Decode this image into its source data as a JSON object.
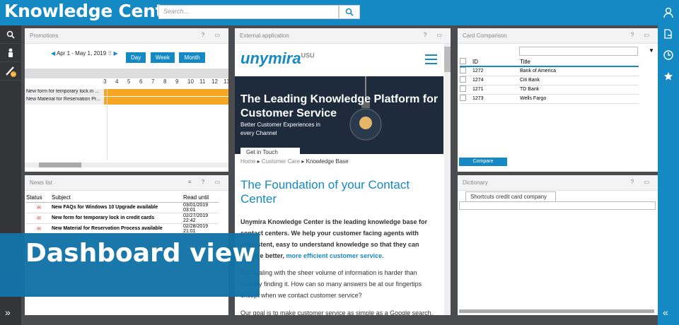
{
  "header": {
    "title": "Knowledge Center",
    "search_placeholder": "Search..."
  },
  "promotions": {
    "title": "Promotions",
    "controls": "? ▭",
    "date_range": "Apr 1 - May 1, 2019",
    "views": [
      "Day",
      "Week",
      "Month"
    ],
    "days": [
      "3",
      "4",
      "5",
      "6",
      "7",
      "8",
      "9",
      "10",
      "11",
      "12",
      "13"
    ],
    "rows": [
      "New form for temporary lock in ...",
      "New Material for Reservation Pr..."
    ]
  },
  "news": {
    "title": "News list",
    "controls": "≡ ? ▭",
    "cols": {
      "status": "Status",
      "subject": "Subject",
      "read_until": "Read until"
    },
    "rows": [
      {
        "subject": "New FAQs for Windows 10 Upgrade available",
        "date": "03/01/2019 03:01"
      },
      {
        "subject": "New form for temporary lock in credit cards",
        "date": "02/27/2019 22:42"
      },
      {
        "subject": "New Material for Reservation Process available",
        "date": "02/28/2019 21:01"
      }
    ]
  },
  "external": {
    "title": "External application",
    "controls": "? ▭",
    "brand": "unymira",
    "brand_sup": "USU",
    "hero_title": "The Leading Knowledge Platform for Customer Service",
    "hero_sub": "Better Customer Experiences in every Channel",
    "hero_button": "Get in Touch",
    "breadcrumb": [
      "Home",
      "Customer Care",
      "Knowledge Base"
    ],
    "heading": "The Foundation of your Contact Center",
    "p1": "Unymira Knowledge Center is the leading knowledge base for contact centers. We help your customer facing agents with consistent, easy to understand knowledge so that they can provide better,",
    "p1_link": "more efficient customer service.",
    "p2": "But dealing with the sheer volume of information is harder than actually finding it.  How can so many answers be at our fingertips except when we contact customer service?",
    "p3": "Our goal is to make customer service as simple as a Google search."
  },
  "cards": {
    "title": "Card Comparison",
    "controls": "? ▭",
    "cols": {
      "id": "ID",
      "title": "Title"
    },
    "rows": [
      {
        "id": "1272",
        "title": "Bank of America"
      },
      {
        "id": "1274",
        "title": "Citi Bank"
      },
      {
        "id": "1271",
        "title": "TD Bank"
      },
      {
        "id": "1273",
        "title": "Wells Fargo"
      }
    ],
    "compare": "Compare"
  },
  "dictionary": {
    "title": "Dictionary",
    "controls": "? ▭",
    "tab": "Shortcuts credit card company"
  },
  "overlay": {
    "label": "Dashboard  view"
  },
  "colors": {
    "brand": "#1589c4",
    "bar": "#f5a623",
    "dark": "#333539"
  }
}
